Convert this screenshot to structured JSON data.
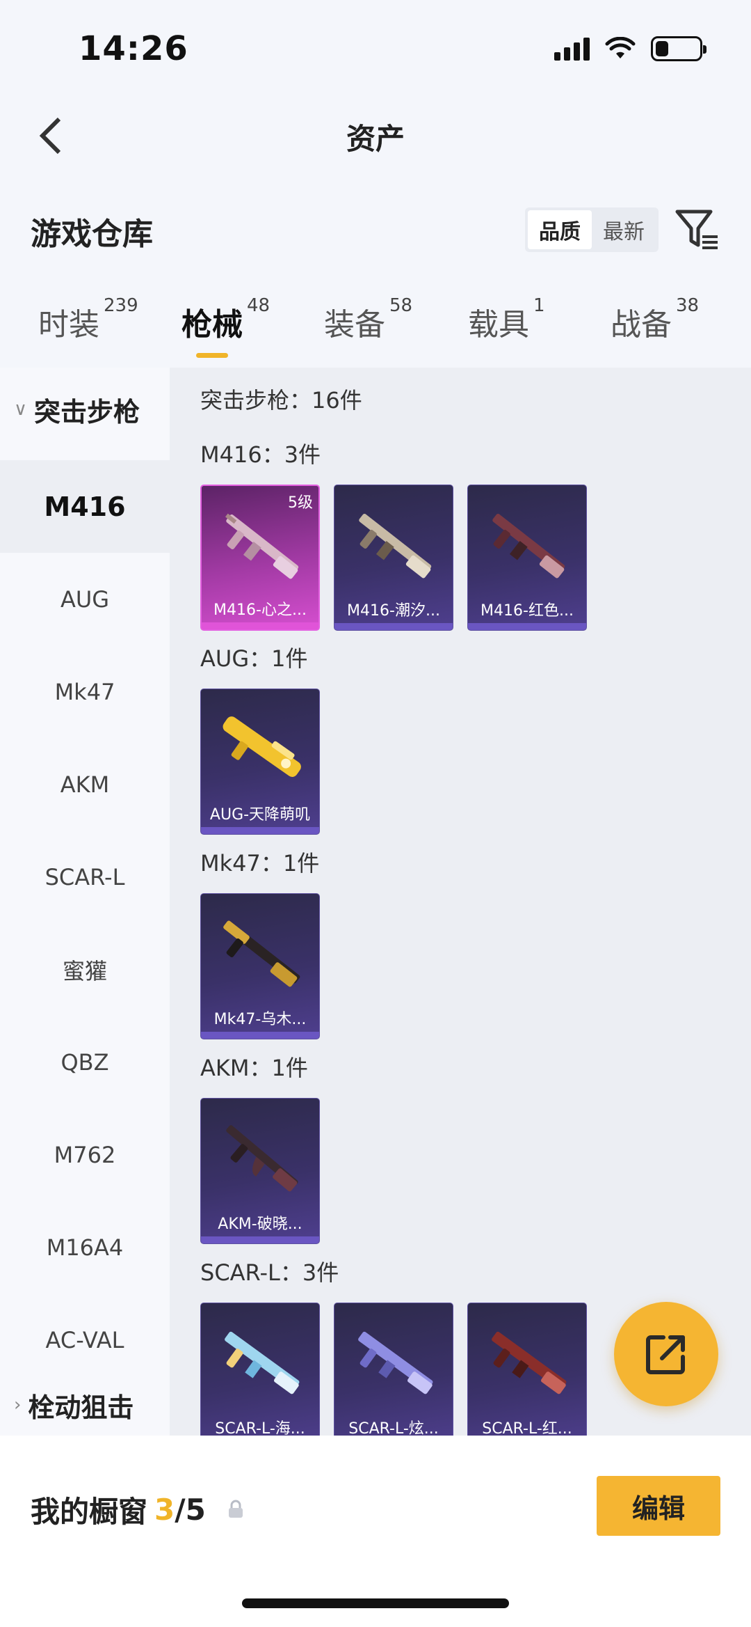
{
  "status_bar": {
    "time": "14:26",
    "battery_level": 0.3
  },
  "header": {
    "title": "资产"
  },
  "warehouse": {
    "title": "游戏仓库",
    "sort_options": [
      "品质",
      "最新"
    ],
    "active_sort": "品质"
  },
  "tabs": [
    {
      "label": "时装",
      "count": "239"
    },
    {
      "label": "枪械",
      "count": "48"
    },
    {
      "label": "装备",
      "count": "58"
    },
    {
      "label": "载具",
      "count": "1"
    },
    {
      "label": "战备",
      "count": "38"
    }
  ],
  "active_tab": "枪械",
  "sidebar": {
    "category": "突击步枪",
    "items": [
      "M416",
      "AUG",
      "Mk47",
      "AKM",
      "SCAR-L",
      "蜜獾",
      "QBZ",
      "M762",
      "M16A4",
      "AC-VAL"
    ],
    "active_item": "M416",
    "next_category": "栓动狙击"
  },
  "content": {
    "category_summary": "突击步枪：16件",
    "sections": [
      {
        "title": "M416：3件",
        "items": [
          {
            "name": "M416-心之...",
            "badge": "5级",
            "rarity": "pink"
          },
          {
            "name": "M416-潮汐...",
            "rarity": "purple"
          },
          {
            "name": "M416-红色...",
            "rarity": "purple"
          }
        ]
      },
      {
        "title": "AUG：1件",
        "items": [
          {
            "name": "AUG-天降萌叽",
            "rarity": "purple"
          }
        ]
      },
      {
        "title": "Mk47：1件",
        "items": [
          {
            "name": "Mk47-乌木...",
            "rarity": "purple"
          }
        ]
      },
      {
        "title": "AKM：1件",
        "items": [
          {
            "name": "AKM-破晓...",
            "rarity": "purple"
          }
        ]
      },
      {
        "title": "SCAR-L：3件",
        "items": [
          {
            "name": "SCAR-L-海...",
            "rarity": "purple"
          },
          {
            "name": "SCAR-L-炫...",
            "rarity": "purple"
          },
          {
            "name": "SCAR-L-红...",
            "rarity": "purple"
          }
        ]
      }
    ]
  },
  "bottom": {
    "showcase_label": "我的橱窗",
    "showcase_current": "3",
    "showcase_total": "/5",
    "edit_label": "编辑"
  },
  "colors": {
    "accent": "#f0b429",
    "fab": "#f5b532",
    "card_purple": "#3a3168",
    "card_pink": "#a23aa4"
  }
}
